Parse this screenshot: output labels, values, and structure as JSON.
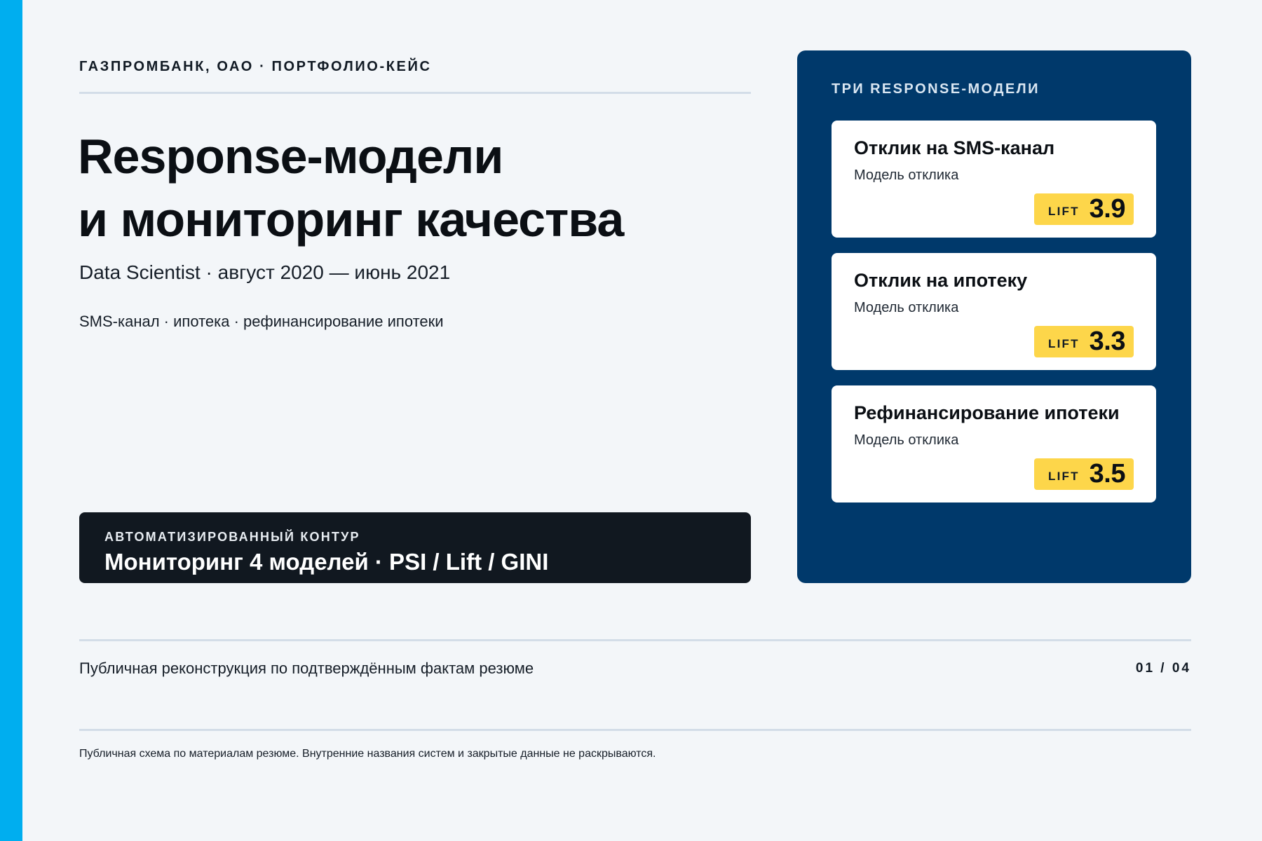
{
  "header": {
    "eyebrow": "ГАЗПРОМБАНК, ОАО · ПОРТФОЛИО-КЕЙС"
  },
  "hero": {
    "title_line1": "Response-модели",
    "title_line2": "и мониторинг качества",
    "role": "Data Scientist · август 2020 — июнь 2021",
    "tags": "SMS-канал · ипотека · рефинансирование ипотеки"
  },
  "contour": {
    "label": "АВТОМАТИЗИРОВАННЫЙ КОНТУР",
    "value": "Мониторинг 4 моделей · PSI / Lift / GINI"
  },
  "panel": {
    "title": "ТРИ RESPONSE-МОДЕЛИ",
    "cards": [
      {
        "title": "Отклик на SMS-канал",
        "subtitle": "Модель отклика",
        "lift_label": "LIFT",
        "lift_value": "3.9"
      },
      {
        "title": "Отклик на ипотеку",
        "subtitle": "Модель отклика",
        "lift_label": "LIFT",
        "lift_value": "3.3"
      },
      {
        "title": "Рефинансирование ипотеки",
        "subtitle": "Модель отклика",
        "lift_label": "LIFT",
        "lift_value": "3.5"
      }
    ]
  },
  "footer": {
    "note": "Публичная реконструкция по подтверждённым фактам резюме",
    "pager": "01 / 04",
    "disclaimer": "Публичная схема по материалам резюме. Внутренние названия систем и закрытые данные не раскрываются."
  },
  "colors": {
    "accent": "#00aeef",
    "panel": "#00396b",
    "lift_badge": "#fdd64a",
    "dark_block": "#111820",
    "background": "#f3f6f9"
  }
}
